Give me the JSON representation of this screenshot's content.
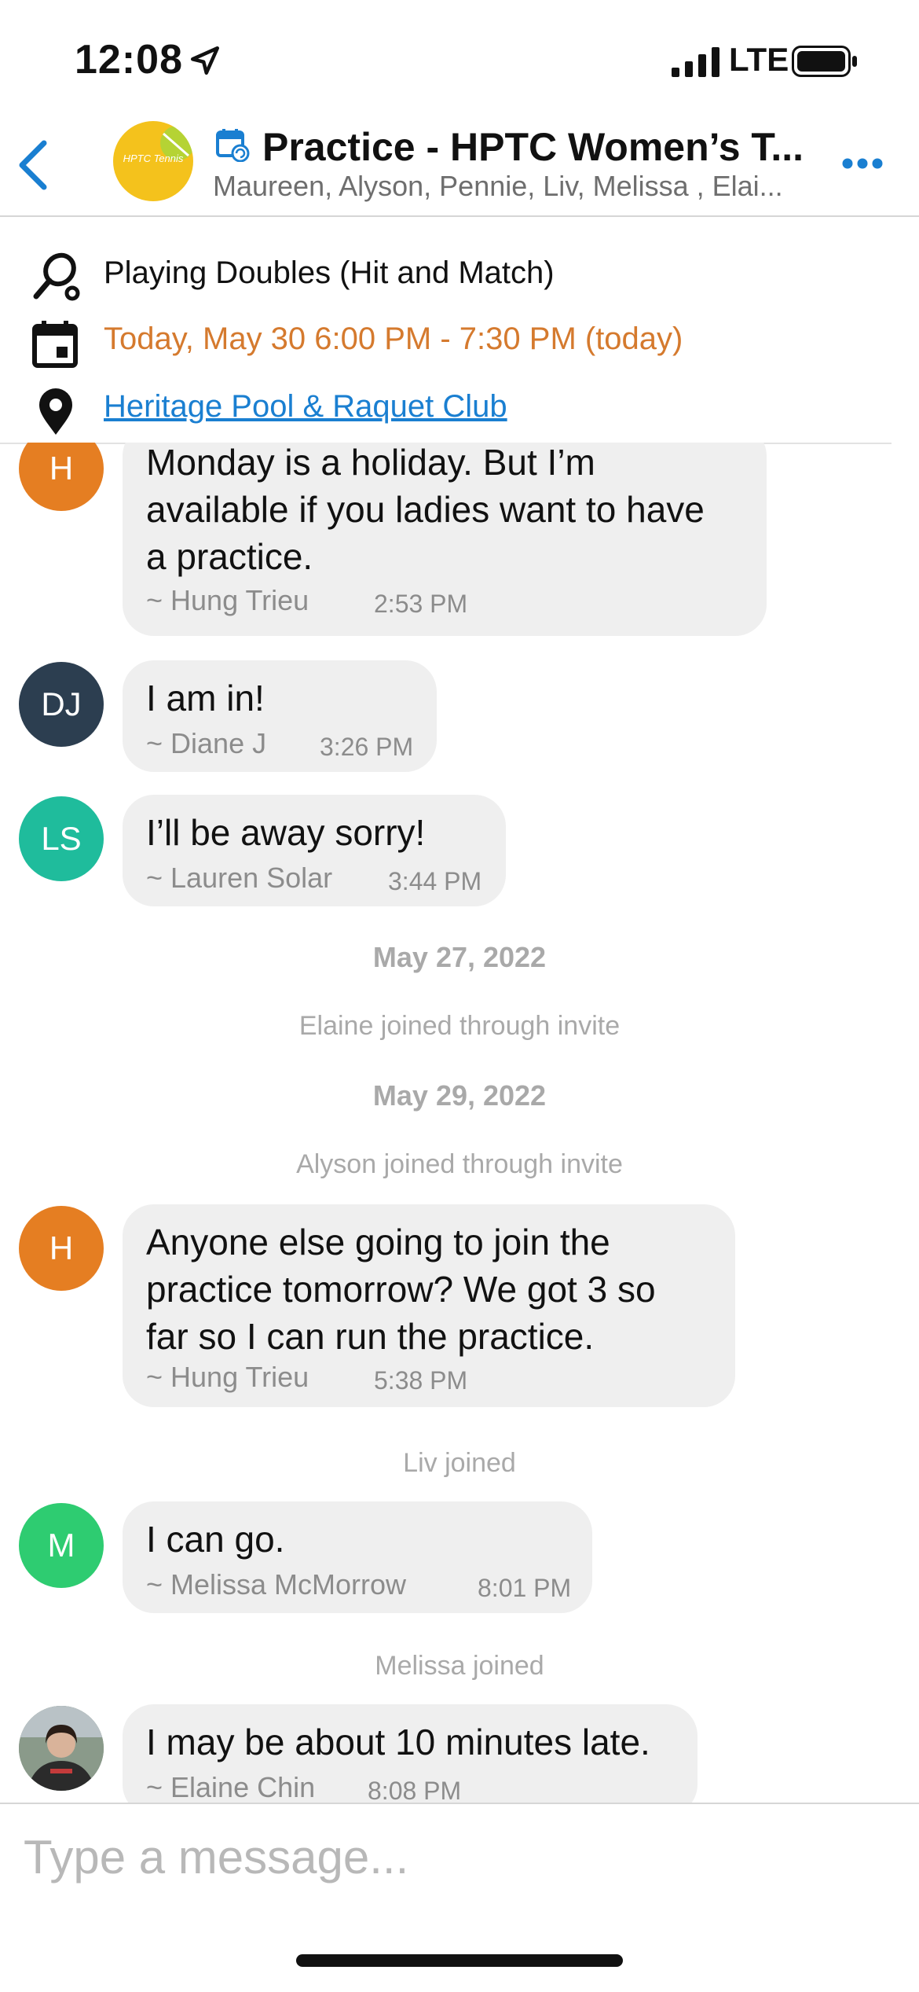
{
  "status_bar": {
    "time": "12:08",
    "network": "LTE"
  },
  "header": {
    "title": "Practice - HPTC Women’s T...",
    "members": "Maureen, Alyson, Pennie, Liv, Melissa , Elai...",
    "avatar_text": "HPTC Tennis"
  },
  "event": {
    "activity": "Playing Doubles (Hit and Match)",
    "datetime": "Today, May 30 6:00 PM - 7:30 PM (today)",
    "location": "Heritage Pool & Raquet Club"
  },
  "messages": [
    {
      "initials": "H",
      "color": "#e57e22",
      "lines": [
        "Monday is a holiday.  But I’m",
        "available if you ladies want to have",
        "a practice."
      ],
      "sender": "~ Hung  Trieu",
      "time": "2:53 PM"
    },
    {
      "initials": "DJ",
      "color": "#2c3e50",
      "lines": [
        "I am in!"
      ],
      "sender": "~ Diane J",
      "time": "3:26 PM"
    },
    {
      "initials": "LS",
      "color": "#1fbc9c",
      "lines": [
        "I’ll be away sorry!"
      ],
      "sender": "~ Lauren Solar",
      "time": "3:44 PM"
    },
    {
      "initials": "H",
      "color": "#e57e22",
      "lines": [
        "Anyone else going to join the",
        "practice tomorrow?  We got 3 so",
        "far so I can run the practice."
      ],
      "sender": "~ Hung  Trieu",
      "time": "5:38 PM"
    },
    {
      "initials": "M",
      "color": "#2ecc71",
      "lines": [
        "I can go."
      ],
      "sender": "~ Melissa  McMorrow",
      "time": "8:01 PM"
    },
    {
      "initials": "",
      "color": "#7a8b7c",
      "lines": [
        "I may be about 10 minutes late."
      ],
      "sender": "~ Elaine Chin",
      "time": "8:08 PM"
    }
  ],
  "date_separators": [
    "May 27, 2022",
    "May 29, 2022"
  ],
  "system_messages": [
    "Elaine joined through invite",
    "Alyson joined through invite",
    "Liv joined",
    "Melissa  joined"
  ],
  "composer": {
    "placeholder": "Type a message..."
  },
  "colors": {
    "accent": "#1a7fd1",
    "date_text": "#d57a2e",
    "bubble": "#efefef"
  }
}
